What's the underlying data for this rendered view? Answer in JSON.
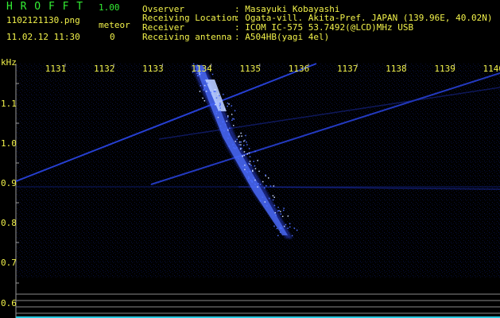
{
  "header": {
    "app_name": "H R O F F T",
    "version": "1.00",
    "filename": "1102121130.png",
    "meteor_label": "meteor",
    "timestamp": "11.02.12 11:30",
    "meteor_count": "0"
  },
  "info": {
    "observer_label": "Ovserver",
    "observer_value": ": Masayuki Kobayashi",
    "location_label": "Receiving Location",
    "location_value": ": Ogata-vill. Akita-Pref. JAPAN (139.96E, 40.02N)",
    "receiver_label": "Receiver",
    "receiver_value": ": ICOM IC-575 53.7492(@LCD)MHz USB",
    "antenna_label": "Receiving antenna",
    "antenna_value": ": A504HB(yagi 4el)"
  },
  "spectrogram": {
    "y_unit": "kHz",
    "x_ticks": [
      "1131",
      "1132",
      "1133",
      "1134",
      "1135",
      "1136",
      "1137",
      "1138",
      "1139",
      "1140"
    ],
    "y_ticks": [
      "1.1",
      "1.0",
      "0.9",
      "0.8",
      "0.7",
      "0.6"
    ],
    "colors": {
      "signal": "#4a6cff",
      "signal_bright": "#c8d8ff",
      "background": "#000000",
      "noise_bg": "#04061a",
      "axis_text": "#f2f24a",
      "grid": "#8a8a8a",
      "bottom_line": "#2ac8e0"
    }
  }
}
